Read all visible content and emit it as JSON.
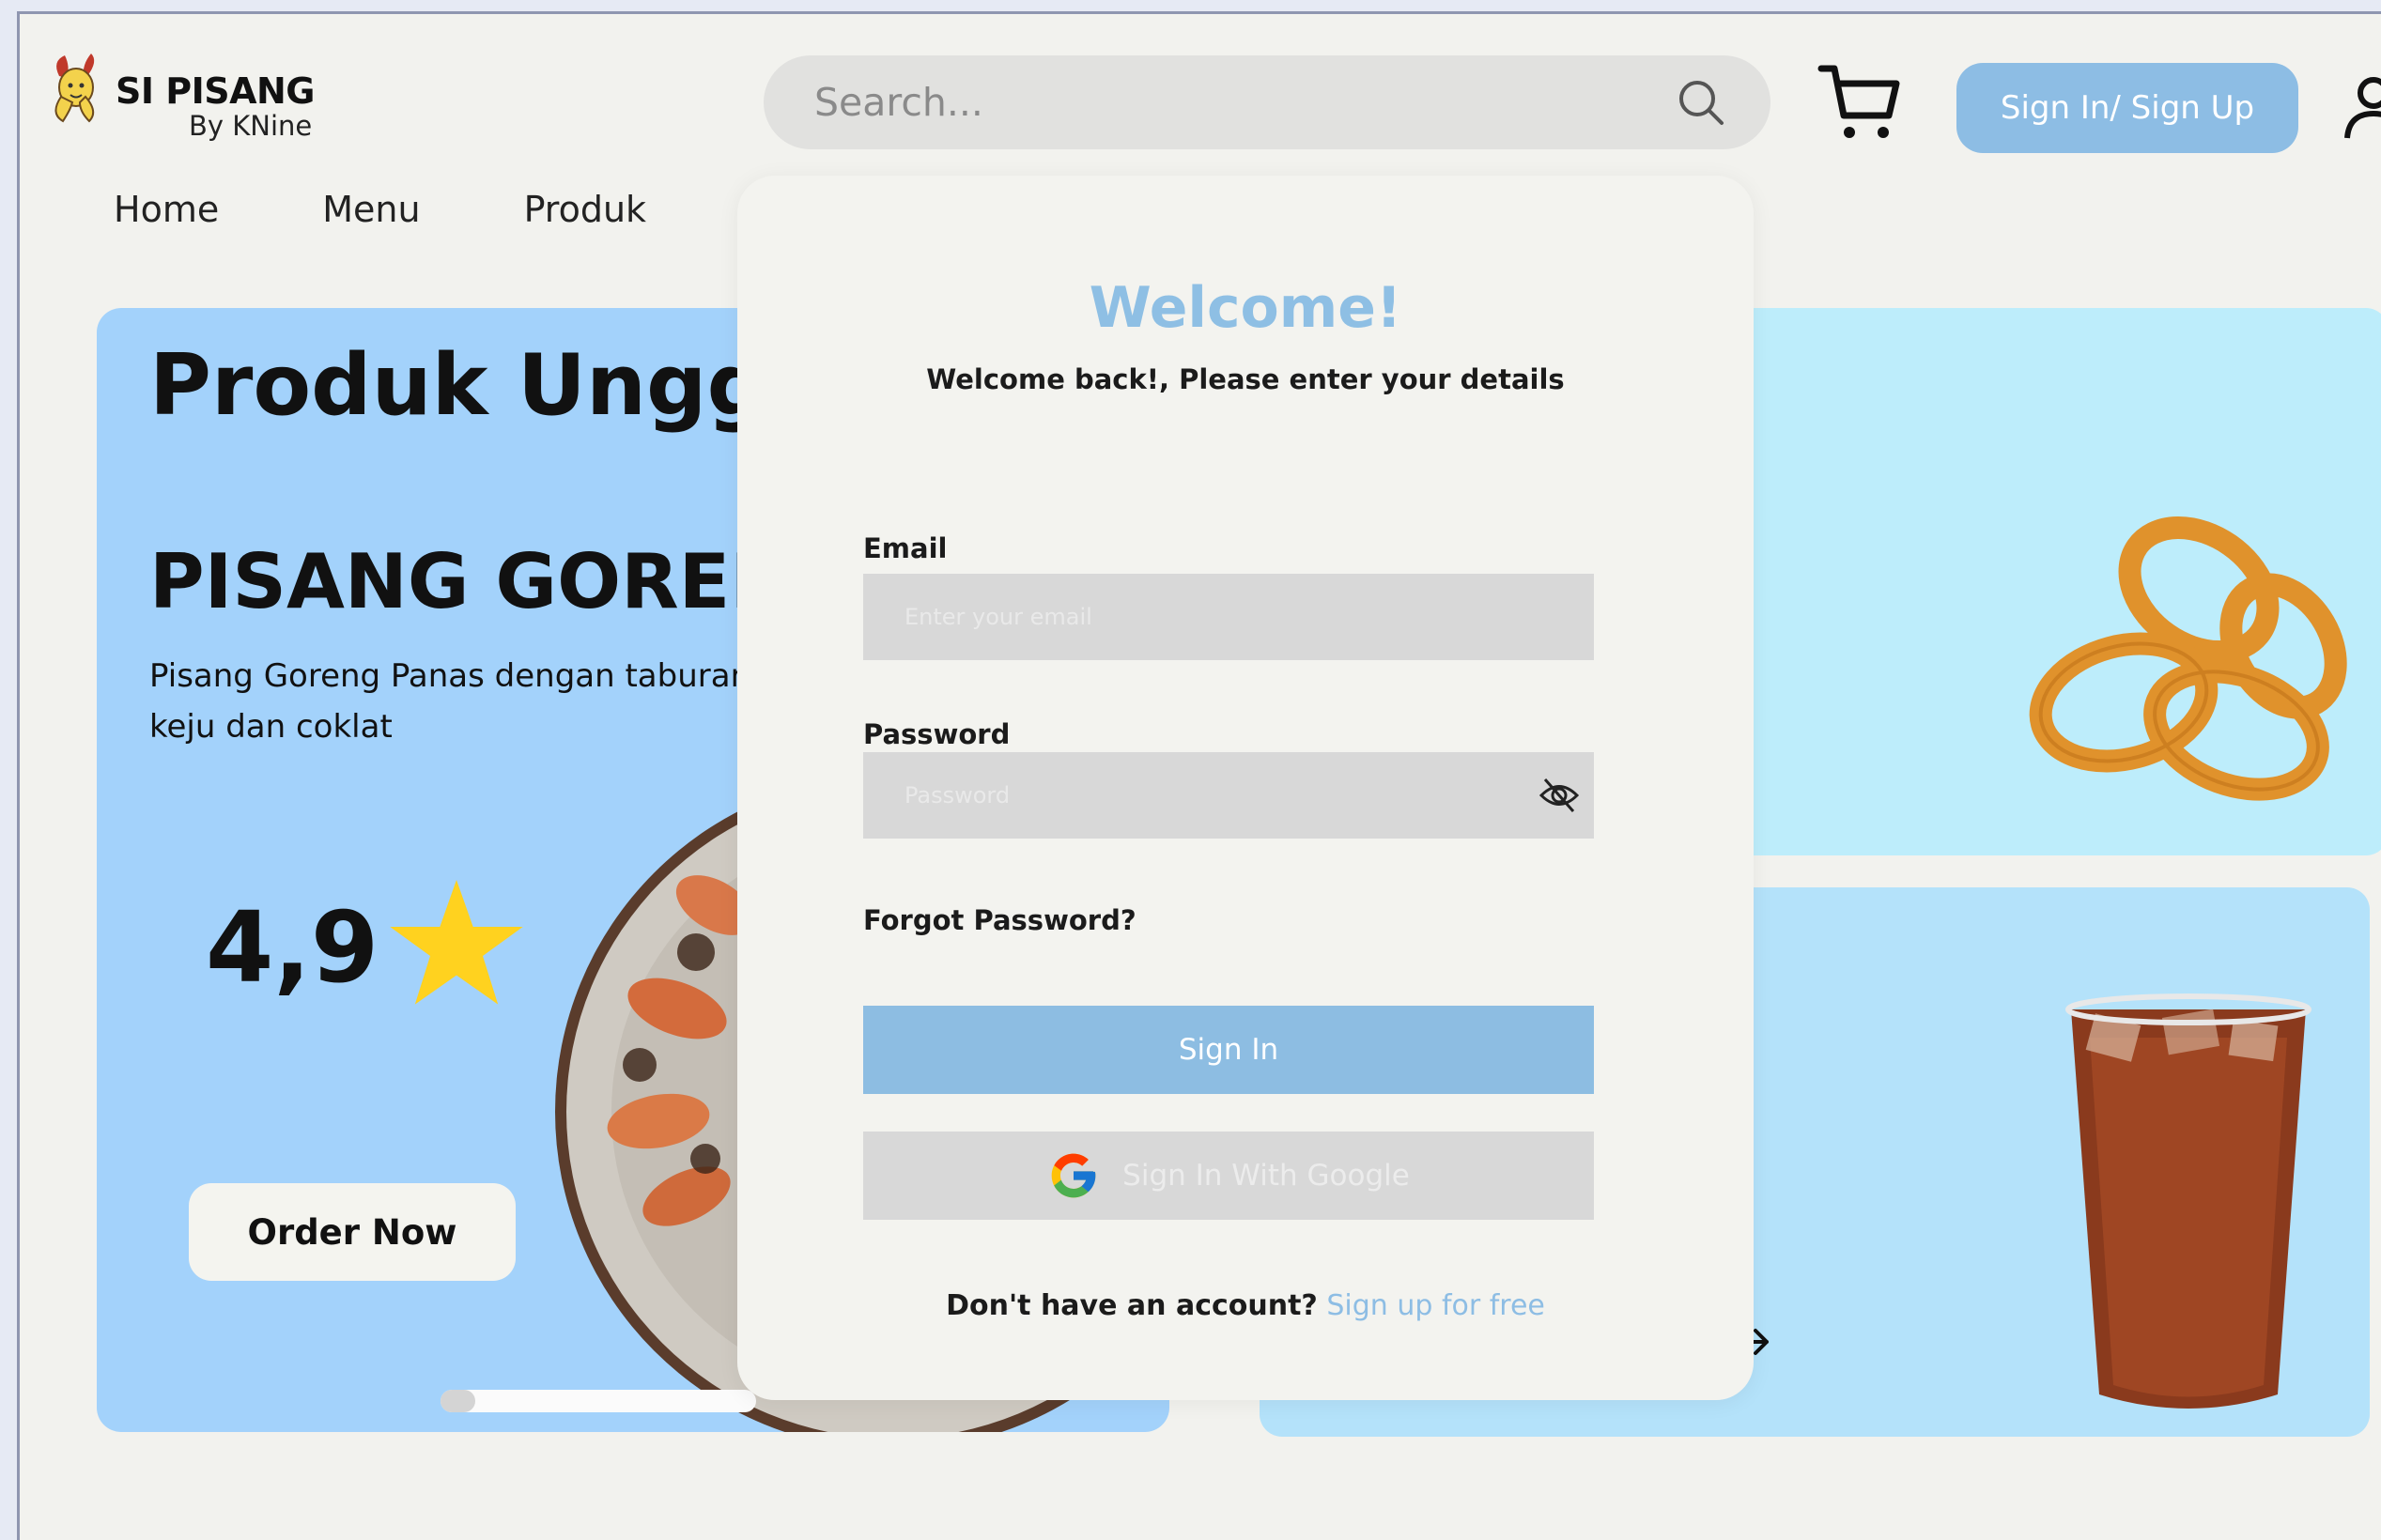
{
  "brand": {
    "name": "SI PISANG",
    "sub": "By KNine"
  },
  "search": {
    "placeholder": "Search..."
  },
  "header": {
    "auth_label": "Sign In/ Sign Up"
  },
  "nav": {
    "items": [
      "Home",
      "Menu",
      "Produk"
    ]
  },
  "hero": {
    "title": "Produk Unggulan",
    "product": "PISANG GORENG",
    "description": "Pisang Goreng Panas dengan taburan keju dan coklat",
    "rating": "4,9",
    "order_label": "Order Now",
    "slider_progress": 0.11
  },
  "login": {
    "title": "Welcome!",
    "subtitle": "Welcome back!, Please enter your details",
    "email_label": "Email",
    "email_placeholder": "Enter your email",
    "password_label": "Password",
    "password_placeholder": "Password",
    "forgot_label": "Forgot Password?",
    "signin_label": "Sign In",
    "google_label": "Sign In With Google",
    "no_account_text": "Don't have an account?",
    "signup_link": "Sign up for free"
  },
  "colors": {
    "accent": "#8dbde4",
    "hero_bg": "#a3d2fb",
    "star": "#ffd21f"
  }
}
